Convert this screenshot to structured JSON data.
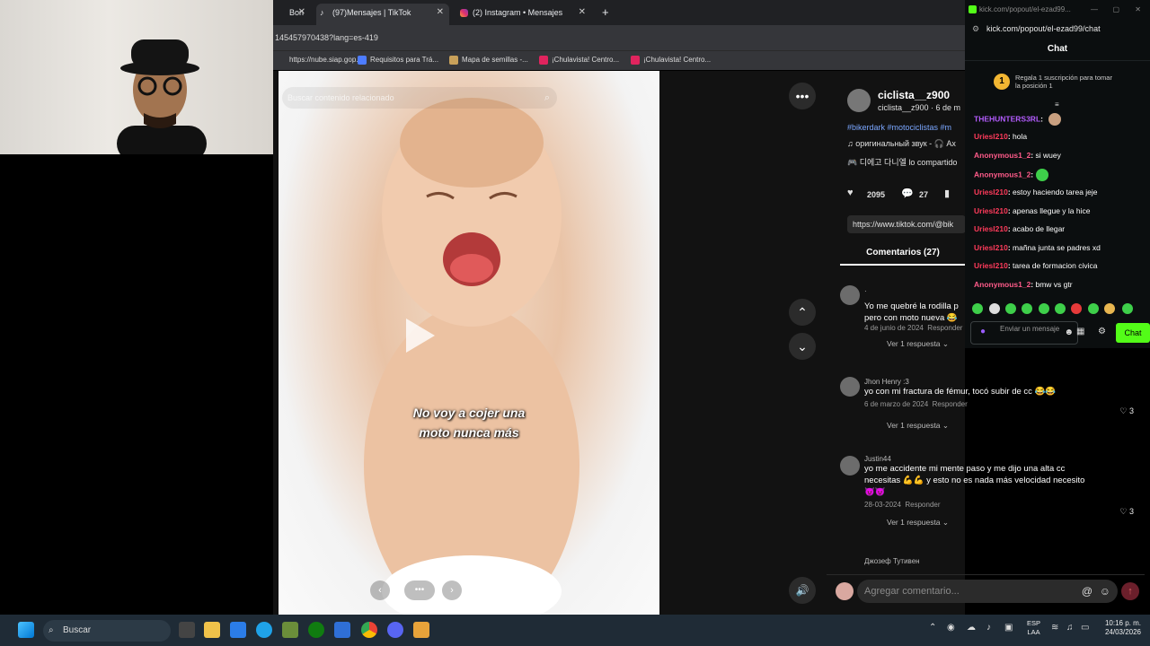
{
  "browser": {
    "tabs": [
      {
        "label": "Bon",
        "favicon": "tiktok-icon",
        "active": false
      },
      {
        "label": "(97)Mensajes | TikTok",
        "favicon": "tiktok-icon",
        "active": true
      },
      {
        "label": "(2) Instagram • Mensajes",
        "favicon": "instagram-icon",
        "active": false
      }
    ],
    "new_tab": "+",
    "url": "145457970438?lang=es-419",
    "bookmarks": [
      "https://nube.siap.gop...",
      "Requisitos para Trá...",
      "Mapa de semillas -...",
      "¡Chulavista! Centro...",
      "¡Chulavista! Centro..."
    ]
  },
  "video": {
    "search_placeholder": "Buscar contenido relacionado",
    "caption_line1": "No voy a cojer una",
    "caption_line2": "moto nunca más"
  },
  "post": {
    "username": "ciclista__z900",
    "meta": "ciclista__z900 · 6 de m",
    "hashtags": "#bikerdark #motociclistas #m",
    "sound": "♫ оригинальный звук - 🎧 Ax",
    "note": "🎮 디에고 다니엘 lo compartido",
    "likes": "2095",
    "comments": "27",
    "link": "https://www.tiktok.com/@bik",
    "comments_tab": "Comentarios (27)"
  },
  "comments": [
    {
      "user": "·",
      "text1": "Yo me quebré la rodilla p",
      "text2": "pero con moto nueva 😂",
      "date": "4 de junio de 2024",
      "reply": "Responder",
      "likes": "",
      "view_replies": "Ver 1 respuesta"
    },
    {
      "user": "Jhon Henry :3",
      "text1": "yo con mi fractura de fémur, tocó subir de cc 😂😂",
      "text2": "",
      "date": "6 de marzo de 2024",
      "reply": "Responder",
      "likes": "3",
      "view_replies": "Ver 1 respuesta"
    },
    {
      "user": "Justin44",
      "text1": "yo me accidente mi mente paso y me dijo una alta cc",
      "text2": "necesitas 💪💪 y esto no es nada más velocidad necesito",
      "text3": "😈😈",
      "date": "28-03-2024",
      "reply": "Responder",
      "likes": "3",
      "view_replies": "Ver 1 respuesta"
    },
    {
      "user": "Джозеф Тутивен",
      "text1": "",
      "date": "",
      "reply": "",
      "likes": "",
      "view_replies": ""
    }
  ],
  "add_comment_placeholder": "Agregar comentario...",
  "kick": {
    "window_title": "kick.com/popout/el-ezad99...",
    "url": "kick.com/popout/el-ezad99/chat",
    "chat_title": "Chat",
    "gift_badge": "1",
    "gift_text1": "Regala 1 suscripción para tomar",
    "gift_text2": "la posición 1",
    "messages": [
      {
        "user": "THEHUNTERS3RL",
        "text": "",
        "color": "#b45cff"
      },
      {
        "user": "Uriesl210",
        "text": "hola",
        "color": "#ff3b5b"
      },
      {
        "user": "Anonymous1_2",
        "text": "si wuey",
        "color": "#ff5b8a"
      },
      {
        "user": "Anonymous1_2",
        "text": "",
        "color": "#ff5b8a"
      },
      {
        "user": "Uriesl210",
        "text": "estoy haciendo tarea jeje",
        "color": "#ff3b5b"
      },
      {
        "user": "Uriesl210",
        "text": "apenas llegue y la hice",
        "color": "#ff3b5b"
      },
      {
        "user": "Uriesl210",
        "text": "acabo de llegar",
        "color": "#ff3b5b"
      },
      {
        "user": "Uriesl210",
        "text": "mañna junta se padres xd",
        "color": "#ff3b5b"
      },
      {
        "user": "Uriesl210",
        "text": "tarea de formacion civica",
        "color": "#ff3b5b"
      },
      {
        "user": "Anonymous1_2",
        "text": "bmw vs gtr",
        "color": "#ff5b8a"
      }
    ],
    "send_placeholder": "Enviar un mensaje",
    "chat_button": "Chat",
    "accent": "#53fc18"
  },
  "taskbar": {
    "search": "Buscar",
    "lang1": "ESP",
    "lang2": "LAA",
    "time": "10:16 p. m.",
    "date": "24/03/2026"
  }
}
